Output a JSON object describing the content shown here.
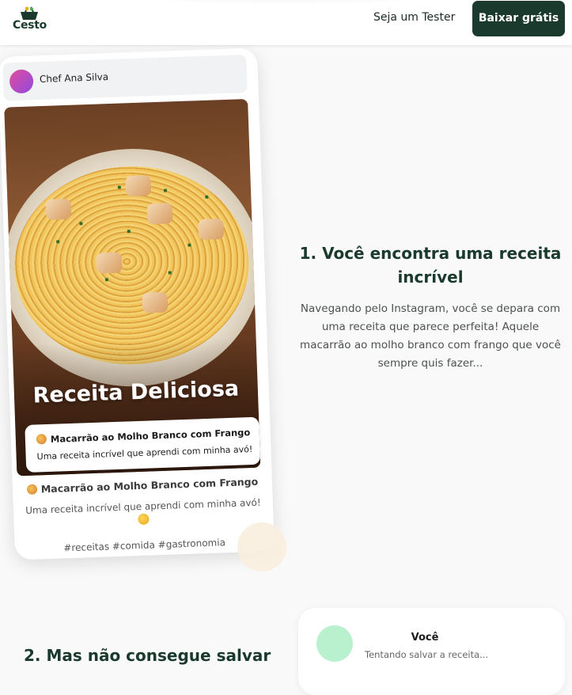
{
  "header": {
    "logo_text": "Cesto",
    "tester_link": "Seja um Tester",
    "download_button": "Baixar grátis"
  },
  "phone": {
    "profile_name": "Chef Ana Silva",
    "photo_title": "Receita Deliciosa",
    "inner_caption": {
      "title": "Macarrão ao Molho Branco com Frango",
      "description": "Uma receita incrível que aprendi com minha avó!"
    },
    "caption": {
      "title": "Macarrão ao Molho Branco com Frango",
      "description": "Uma receita incrível que aprendi com minha avó!",
      "hashtags": "#receitas #comida #gastronomia"
    }
  },
  "step1": {
    "title": "1. Você encontra uma receita incrível",
    "body": "Navegando pelo Instagram, você se depara com uma receita que parece perfeita! Aquele macarrão ao molho branco com frango que você sempre quis fazer..."
  },
  "step2": {
    "title": "2. Mas não consegue salvar",
    "chat": {
      "name": "Você",
      "status": "Tentando salvar a receita..."
    }
  },
  "colors": {
    "brand_dark": "#1b3a2e",
    "avatar_you": "#b9f1cf",
    "avatar_ana_start": "#e24c9c",
    "avatar_ana_end": "#8f4ae0"
  },
  "icons": [
    "basket-logo-icon",
    "pasta-emoji-icon",
    "smile-emoji-icon"
  ]
}
